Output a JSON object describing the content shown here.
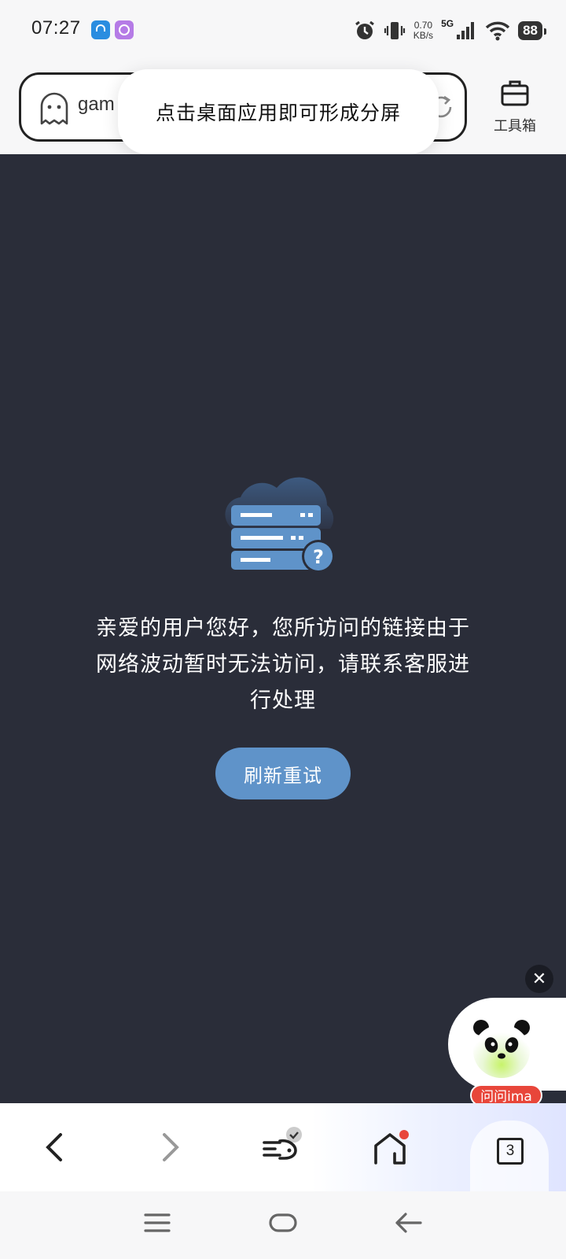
{
  "status_bar": {
    "time": "07:27",
    "net_speed_value": "0.70",
    "net_speed_unit": "KB/s",
    "signal_label": "5G",
    "battery": "88"
  },
  "address_bar": {
    "url_text": "gam",
    "toolbox_label": "工具箱"
  },
  "toast": {
    "message": "点击桌面应用即可形成分屏"
  },
  "error_page": {
    "message": "亲爱的用户您好，您所访问的链接由于网络波动暂时无法访问，请联系客服进行处理",
    "refresh_label": "刷新重试"
  },
  "floating_assistant": {
    "label": "问问ima",
    "close_symbol": "✕"
  },
  "bottom_toolbar": {
    "tab_count": "3"
  },
  "colors": {
    "content_background": "#2a2d39",
    "refresh_button": "#5f93c9",
    "notification_dot": "#e8463a"
  },
  "icons": [
    "ghost-icon",
    "reload-icon",
    "briefcase-icon",
    "server-cloud-icon",
    "back-icon",
    "forward-icon",
    "feeds-icon",
    "home-icon",
    "tabs-icon",
    "menu-icon",
    "home-nav-icon",
    "back-nav-icon"
  ]
}
